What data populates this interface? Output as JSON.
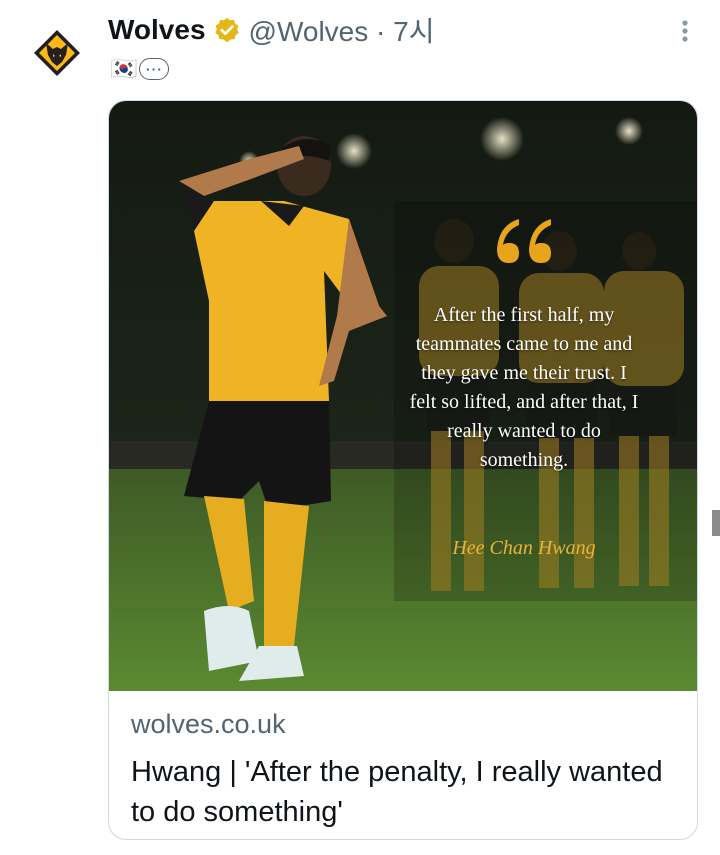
{
  "tweet": {
    "display_name": "Wolves",
    "handle_time": "@Wolves · 7시",
    "flag_emoji": "🇰🇷",
    "more_emoji_label": "···"
  },
  "card": {
    "quote": "After the first half, my teammates came to me and they gave me their trust. I felt so lifted, and after that, I really wanted to do something.",
    "quote_author": "Hee Chan Hwang",
    "domain": "wolves.co.uk",
    "title": "Hwang | 'After the penalty, I really wanted to do something'"
  },
  "colors": {
    "brand_gold": "#fdb913",
    "verified_gold": "#e2b719",
    "text_primary": "#0f1419",
    "text_secondary": "#536471"
  }
}
